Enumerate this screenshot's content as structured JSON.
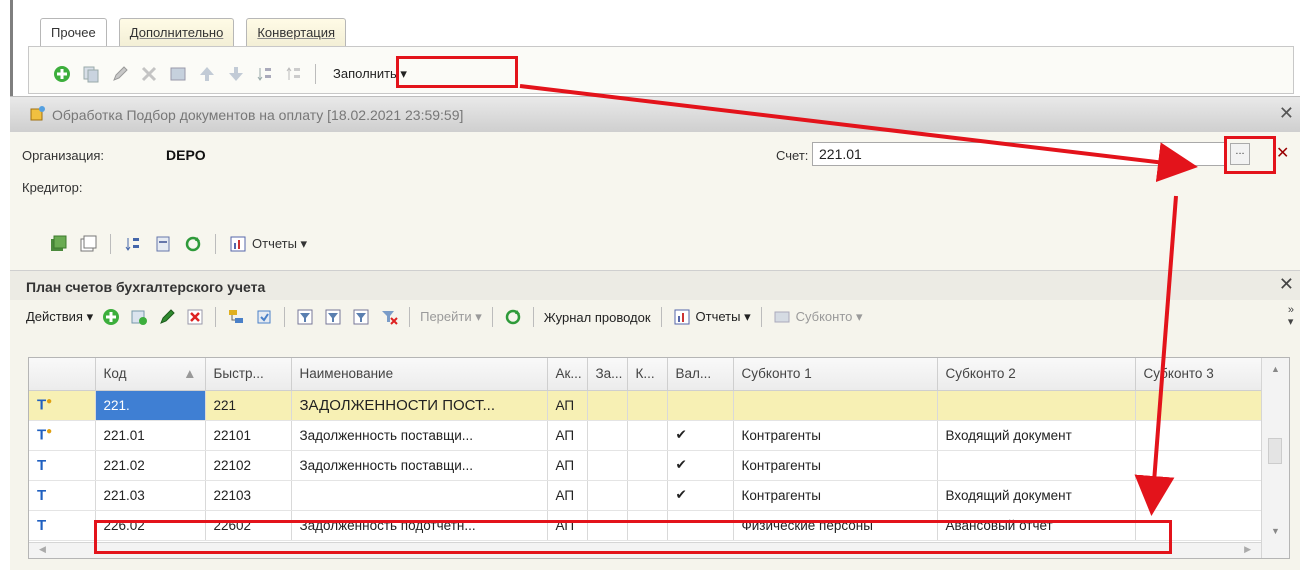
{
  "tabs": [
    {
      "label": "Прочее"
    },
    {
      "label": "Дополнительно"
    },
    {
      "label": "Конвертация"
    }
  ],
  "toolbar1": {
    "fill_label": "Заполнить ▾"
  },
  "processing": {
    "title": "Обработка  Подбор документов на оплату [18.02.2021 23:59:59]",
    "org_label": "Организация:",
    "org_value": "DEPO",
    "account_label": "Счет:",
    "account_value": "221.01",
    "creditor_label": "Кредитор:",
    "reports_label": "Отчеты ▾"
  },
  "coa": {
    "title": "План счетов бухгалтерского учета",
    "actions_label": "Действия ▾",
    "goto_label": "Перейти ▾",
    "journal_label": "Журнал проводок",
    "reports_label": "Отчеты ▾",
    "subconto_label": "Субконто ▾",
    "columns": [
      "Код",
      "Быстр...",
      "Наименование",
      "Ак...",
      "За...",
      "К...",
      "Вал...",
      "Субконто 1",
      "Субконто 2",
      "Субконто 3"
    ],
    "rows": [
      {
        "icon": "Т",
        "code": "221.",
        "quick": "221",
        "name": "ЗАДОЛЖЕННОСТИ ПОСТ...",
        "type": "АП",
        "val": "",
        "s1": "",
        "s2": ""
      },
      {
        "icon": "Т",
        "code": "221.01",
        "quick": "22101",
        "name": "Задолженность поставщи...",
        "type": "АП",
        "val": "✔",
        "s1": "Контрагенты",
        "s2": "Входящий документ"
      },
      {
        "icon": "Т",
        "code": "221.02",
        "quick": "22102",
        "name": "Задолженность поставщи...",
        "type": "АП",
        "val": "✔",
        "s1": "Контрагенты",
        "s2": ""
      },
      {
        "icon": "Т",
        "code": "221.03",
        "quick": "22103",
        "name": "",
        "type": "АП",
        "val": "✔",
        "s1": "Контрагенты",
        "s2": "Входящий документ"
      },
      {
        "icon": "Т",
        "code": "226.02",
        "quick": "22602",
        "name": "Задолженность подотчетн...",
        "type": "АП",
        "val": "",
        "s1": "Физические персоны",
        "s2": "Авансовый отчет"
      }
    ]
  },
  "colors": {
    "annotation": "#e3131b",
    "selection": "#3f7fd3",
    "row_highlight": "#f7f0b4"
  }
}
